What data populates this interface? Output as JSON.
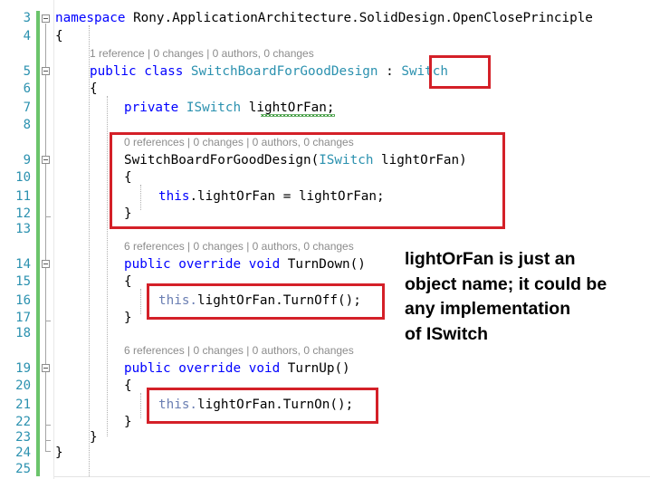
{
  "line_numbers": [
    "3",
    "4",
    "5",
    "6",
    "7",
    "8",
    "9",
    "10",
    "11",
    "12",
    "13",
    "14",
    "15",
    "16",
    "17",
    "18",
    "19",
    "20",
    "21",
    "22",
    "23",
    "24",
    "25"
  ],
  "code": {
    "ns_kw": "namespace",
    "ns_name": " Rony.ApplicationArchitecture.SolidDesign.OpenClosePrinciple",
    "open_ns": "{",
    "lens_class": "1 reference | 0 changes | 0 authors, 0 changes",
    "class_public": "public",
    "class_kw": "class",
    "class_name": "SwitchBoardForGoodDesign",
    "class_colon": " : ",
    "class_base": "Switch",
    "class_open": "{",
    "field_private": "private",
    "field_type": "ISwitch",
    "field_name": "lightOrFan",
    "field_semicolon": ";",
    "lens_ctor": "0 references | 0 changes | 0 authors, 0 changes",
    "ctor_name": "SwitchBoardForGoodDesign(",
    "ctor_param_type": "ISwitch",
    "ctor_param_name": " lightOrFan)",
    "ctor_open": "{",
    "ctor_this": "this",
    "ctor_assign": ".lightOrFan = lightOrFan;",
    "ctor_close": "}",
    "lens_down": "6 references | 0 changes | 0 authors, 0 changes",
    "down_public": "public",
    "down_override": "override",
    "down_void": "void",
    "down_name": " TurnDown()",
    "down_open": "{",
    "down_this": "this.",
    "down_call": "lightOrFan.TurnOff();",
    "down_close": "}",
    "lens_up": "6 references | 0 changes | 0 authors, 0 changes",
    "up_public": "public",
    "up_override": "override",
    "up_void": "void",
    "up_name": " TurnUp()",
    "up_open": "{",
    "up_this": "this.",
    "up_call": "lightOrFan.TurnOn();",
    "up_close": "}",
    "class_close": "}",
    "ns_close": "}"
  },
  "annotation": {
    "lines": [
      "lightOrFan is just an",
      "object name; it could be",
      "any implementation",
      "of ISwitch"
    ]
  },
  "colors": {
    "keyword": "#0000ff",
    "type": "#2b91af",
    "highlight_box": "#d42028",
    "codelens": "#8c8c8c"
  }
}
